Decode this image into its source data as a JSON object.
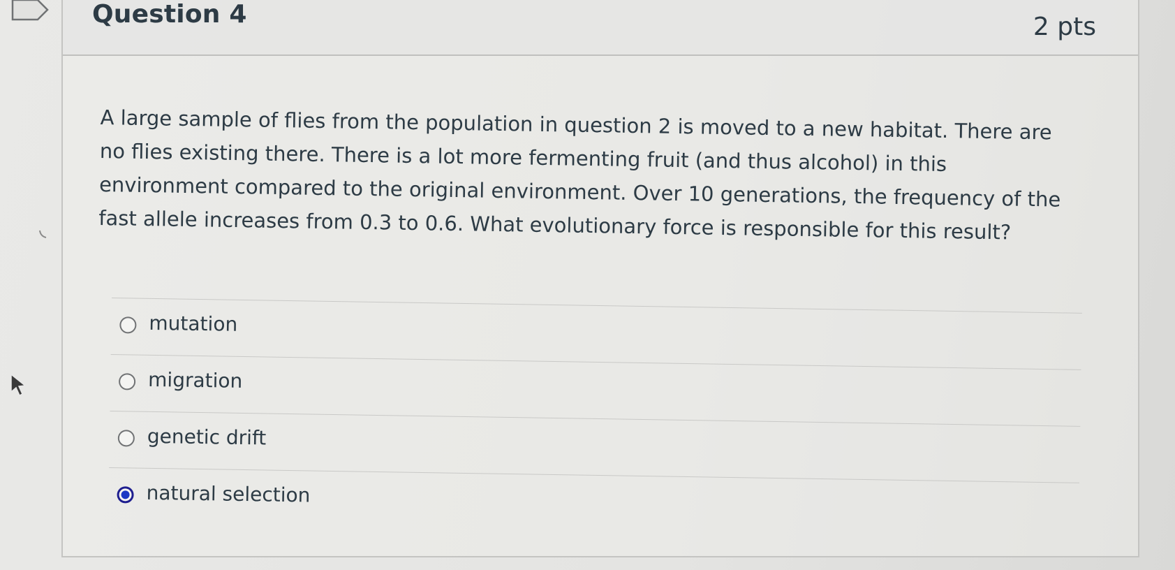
{
  "question": {
    "title": "Question 4",
    "points": "2 pts",
    "text": "A large sample of flies from the population in question 2 is moved to a new habitat. There are no flies existing there. There is a lot more fermenting fruit (and thus alcohol) in this environment compared to the original environment. Over 10 generations, the frequency of the fast allele increases from 0.3 to 0.6. What evolutionary force is responsible for this result?"
  },
  "answers": [
    {
      "label": "mutation",
      "selected": false
    },
    {
      "label": "migration",
      "selected": false
    },
    {
      "label": "genetic drift",
      "selected": false
    },
    {
      "label": "natural selection",
      "selected": true
    }
  ],
  "icons": {
    "flag": "flag-icon",
    "cursor": "cursor-icon"
  },
  "colors": {
    "text": "#2d3b45",
    "selected_radio": "#1d39c4"
  }
}
